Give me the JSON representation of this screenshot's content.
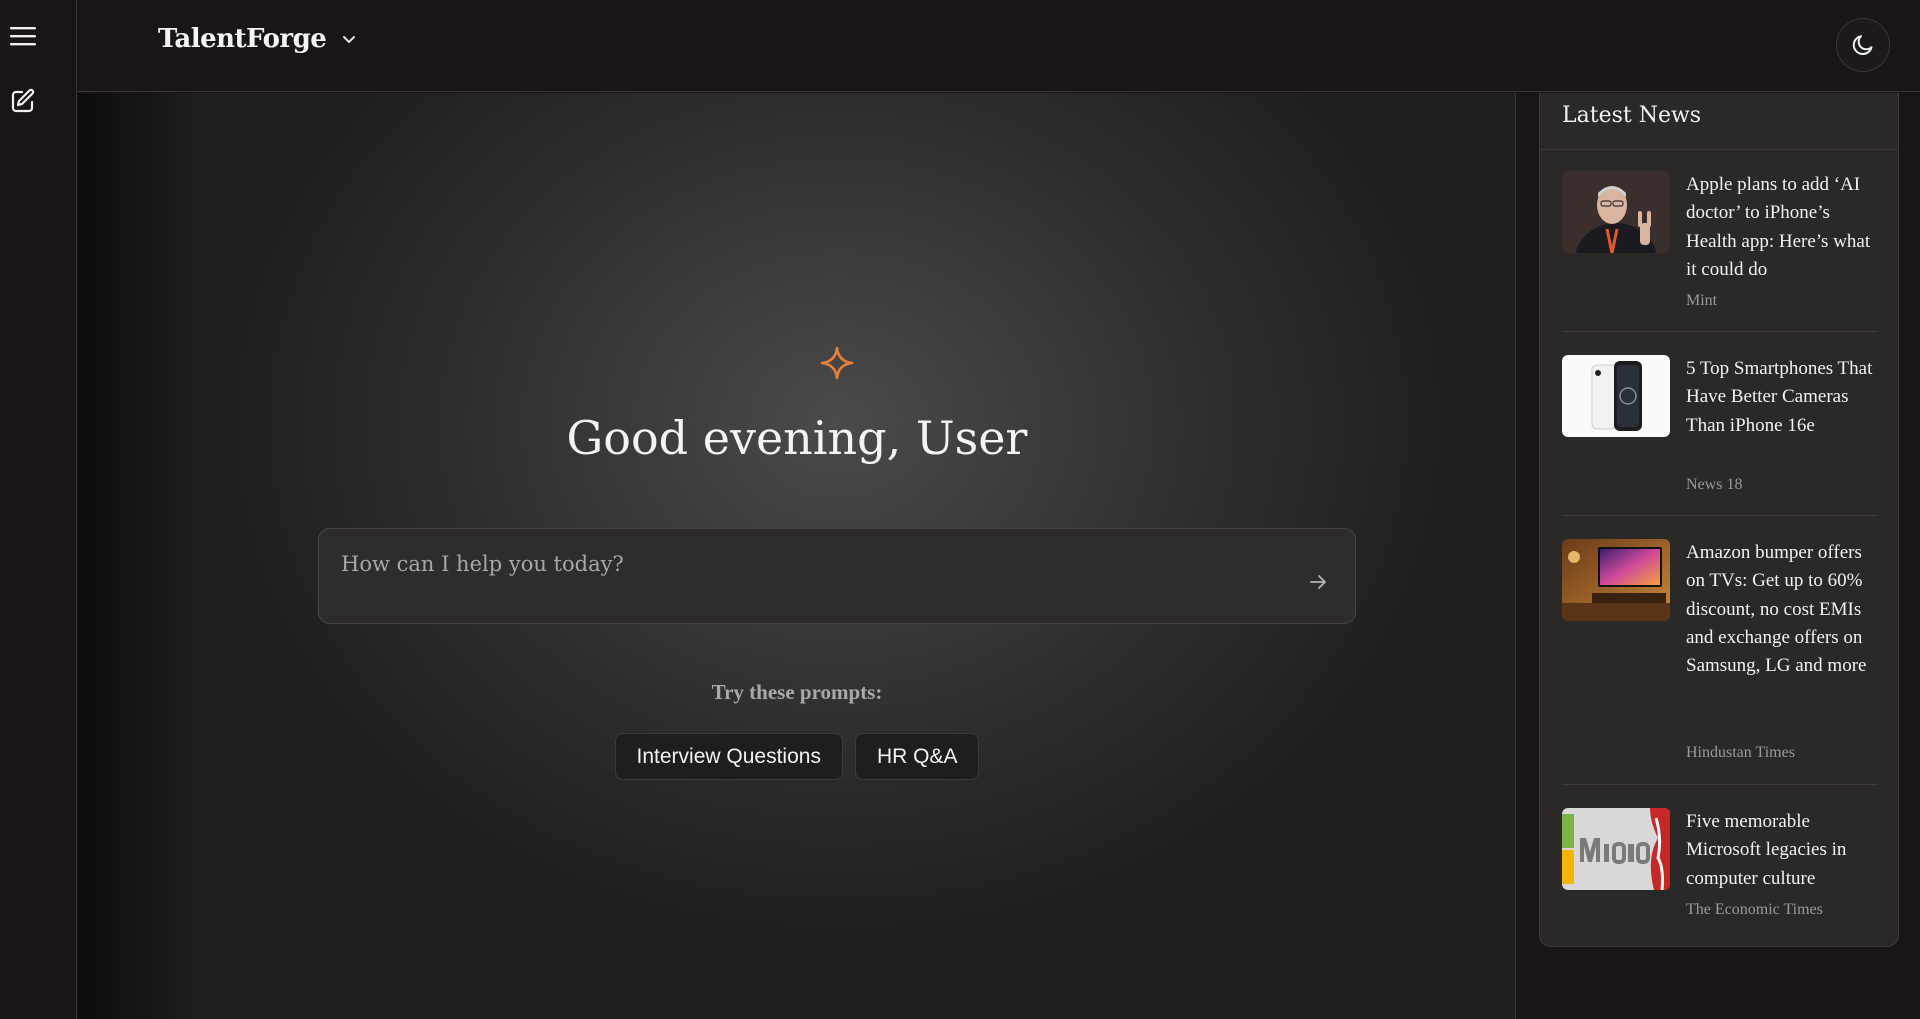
{
  "header": {
    "brand": "TalentForge"
  },
  "rail": {
    "menu_icon": "hamburger-icon",
    "new_chat_icon": "edit-icon"
  },
  "theme_toggle_icon": "moon-icon",
  "main": {
    "icon": "sparkle-icon",
    "greeting": "Good evening, User",
    "prompt_placeholder": "How can I help you today?",
    "try_label": "Try these prompts:",
    "prompts": [
      "Interview Questions",
      "HR Q&A"
    ]
  },
  "news": {
    "title": "Latest News",
    "items": [
      {
        "headline": "Apple plans to add ‘AI doctor’ to iPhone’s Health app: Here’s what it could do",
        "source": "Mint"
      },
      {
        "headline": "5 Top Smartphones That Have Better Cameras Than iPhone 16e",
        "source": "News 18"
      },
      {
        "headline": "Amazon bumper offers on TVs: Get up to 60% discount, no cost EMIs and exchange offers on Samsung, LG and more",
        "source": "Hindustan Times"
      },
      {
        "headline": "Five memorable Microsoft legacies in computer culture",
        "source": "The Economic Times"
      }
    ]
  },
  "colors": {
    "accent": "#e8803a",
    "background": "#1a1616",
    "panel": "#2b2828"
  }
}
